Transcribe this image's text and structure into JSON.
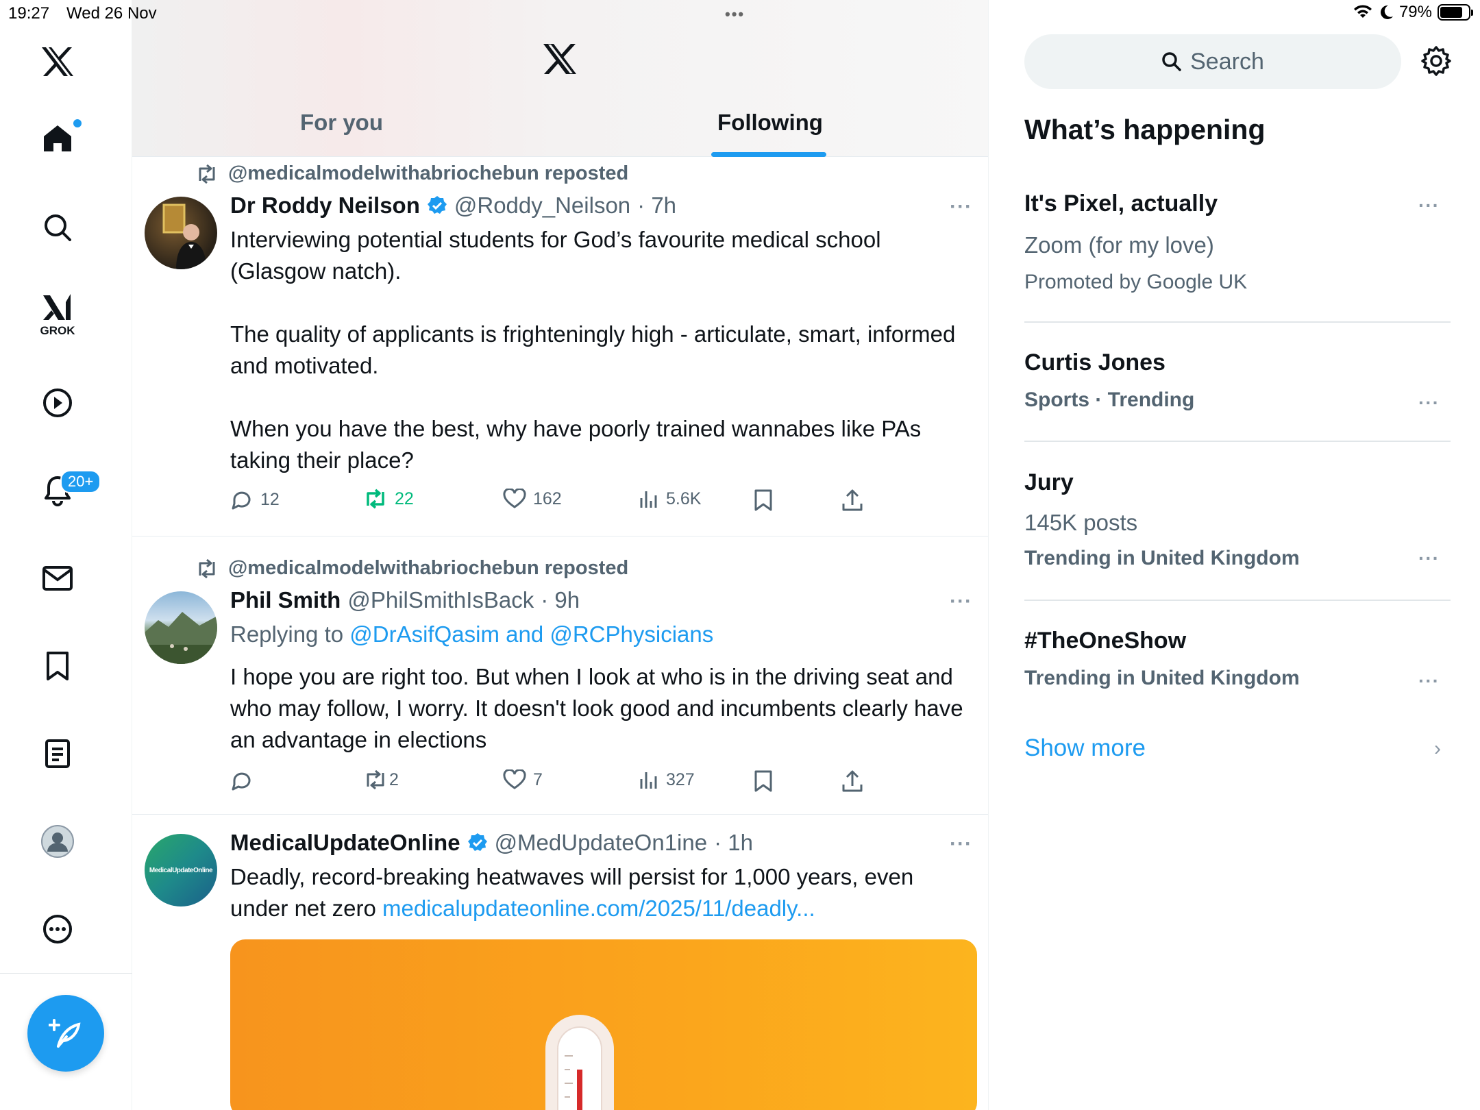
{
  "status_bar": {
    "time": "19:27",
    "date": "Wed 26 Nov",
    "battery": "79%",
    "battery_level": 0.79,
    "dots": "•••"
  },
  "sidebar": {
    "items": [
      {
        "name": "x-logo"
      },
      {
        "name": "home"
      },
      {
        "name": "search"
      },
      {
        "name": "grok",
        "label": "GROK"
      },
      {
        "name": "videos"
      },
      {
        "name": "notifications"
      },
      {
        "name": "messages"
      },
      {
        "name": "bookmarks"
      },
      {
        "name": "lists"
      },
      {
        "name": "profile"
      },
      {
        "name": "more"
      }
    ],
    "notification_badge": "20+"
  },
  "main": {
    "tabs": [
      {
        "label": "For you"
      },
      {
        "label": "Following"
      }
    ],
    "active_tab": "Following"
  },
  "tweets": [
    {
      "repost": "@medicalmodelwithabriochebun reposted",
      "name": "Dr Roddy Neilson",
      "verified": true,
      "handle": "@Roddy_Neilson",
      "time": "· 7h",
      "more": "···",
      "body": "Interviewing potential students for God’s favourite medical school (Glasgow natch).\n\nThe quality of applicants is frighteningly high - articulate, smart, informed and motivated.\n\nWhen you have the best, why have poorly trained wannabes like PAs taking their place?",
      "replies": "12",
      "reposts": "22",
      "likes": "162",
      "views": "5.6K"
    },
    {
      "repost": "@medicalmodelwithabriochebun reposted",
      "name": "Phil Smith",
      "verified": false,
      "handle": "@PhilSmithIsBack",
      "time": "· 9h",
      "more": "···",
      "replying_prefix": "Replying to ",
      "replying_to": "@DrAsifQasim and @RCPhysicians",
      "body": "I hope you are right too. But when I look at who is in the driving seat and who may follow, I worry. It doesn't look good and incumbents clearly have an advantage in elections",
      "replies": "",
      "reposts": "2",
      "likes": "7",
      "views": "327"
    },
    {
      "name": "MedicalUpdateOnline",
      "verified": true,
      "handle": "@MedUpdateOn1ine",
      "time": "· 1h",
      "more": "···",
      "avatar_text": "MedicalUpdateOnline",
      "body": "Deadly, record-breaking heatwaves will persist for 1,000 years, even under net zero ",
      "link": "medicalupdateonline.com/2025/11/deadly..."
    }
  ],
  "right": {
    "search_placeholder": "Search",
    "heading": "What’s happening",
    "trends": [
      {
        "title": "It's Pixel, actually",
        "subtitle": "Zoom (for my love)",
        "meta": "Promoted by Google UK",
        "more": "···"
      },
      {
        "title": "Curtis Jones",
        "meta": "Sports · Trending",
        "more": "···"
      },
      {
        "title": "Jury",
        "subtitle": "145K posts",
        "meta": "Trending in United Kingdom",
        "more": "···"
      },
      {
        "title": "#TheOneShow",
        "meta": "Trending in United Kingdom",
        "more": "···"
      }
    ],
    "show_more": "Show more",
    "chevron": "›"
  },
  "colors": {
    "accent": "#1d9bf0",
    "text": "#0f1419",
    "muted": "#536471",
    "repost_green": "#00ba7c"
  }
}
